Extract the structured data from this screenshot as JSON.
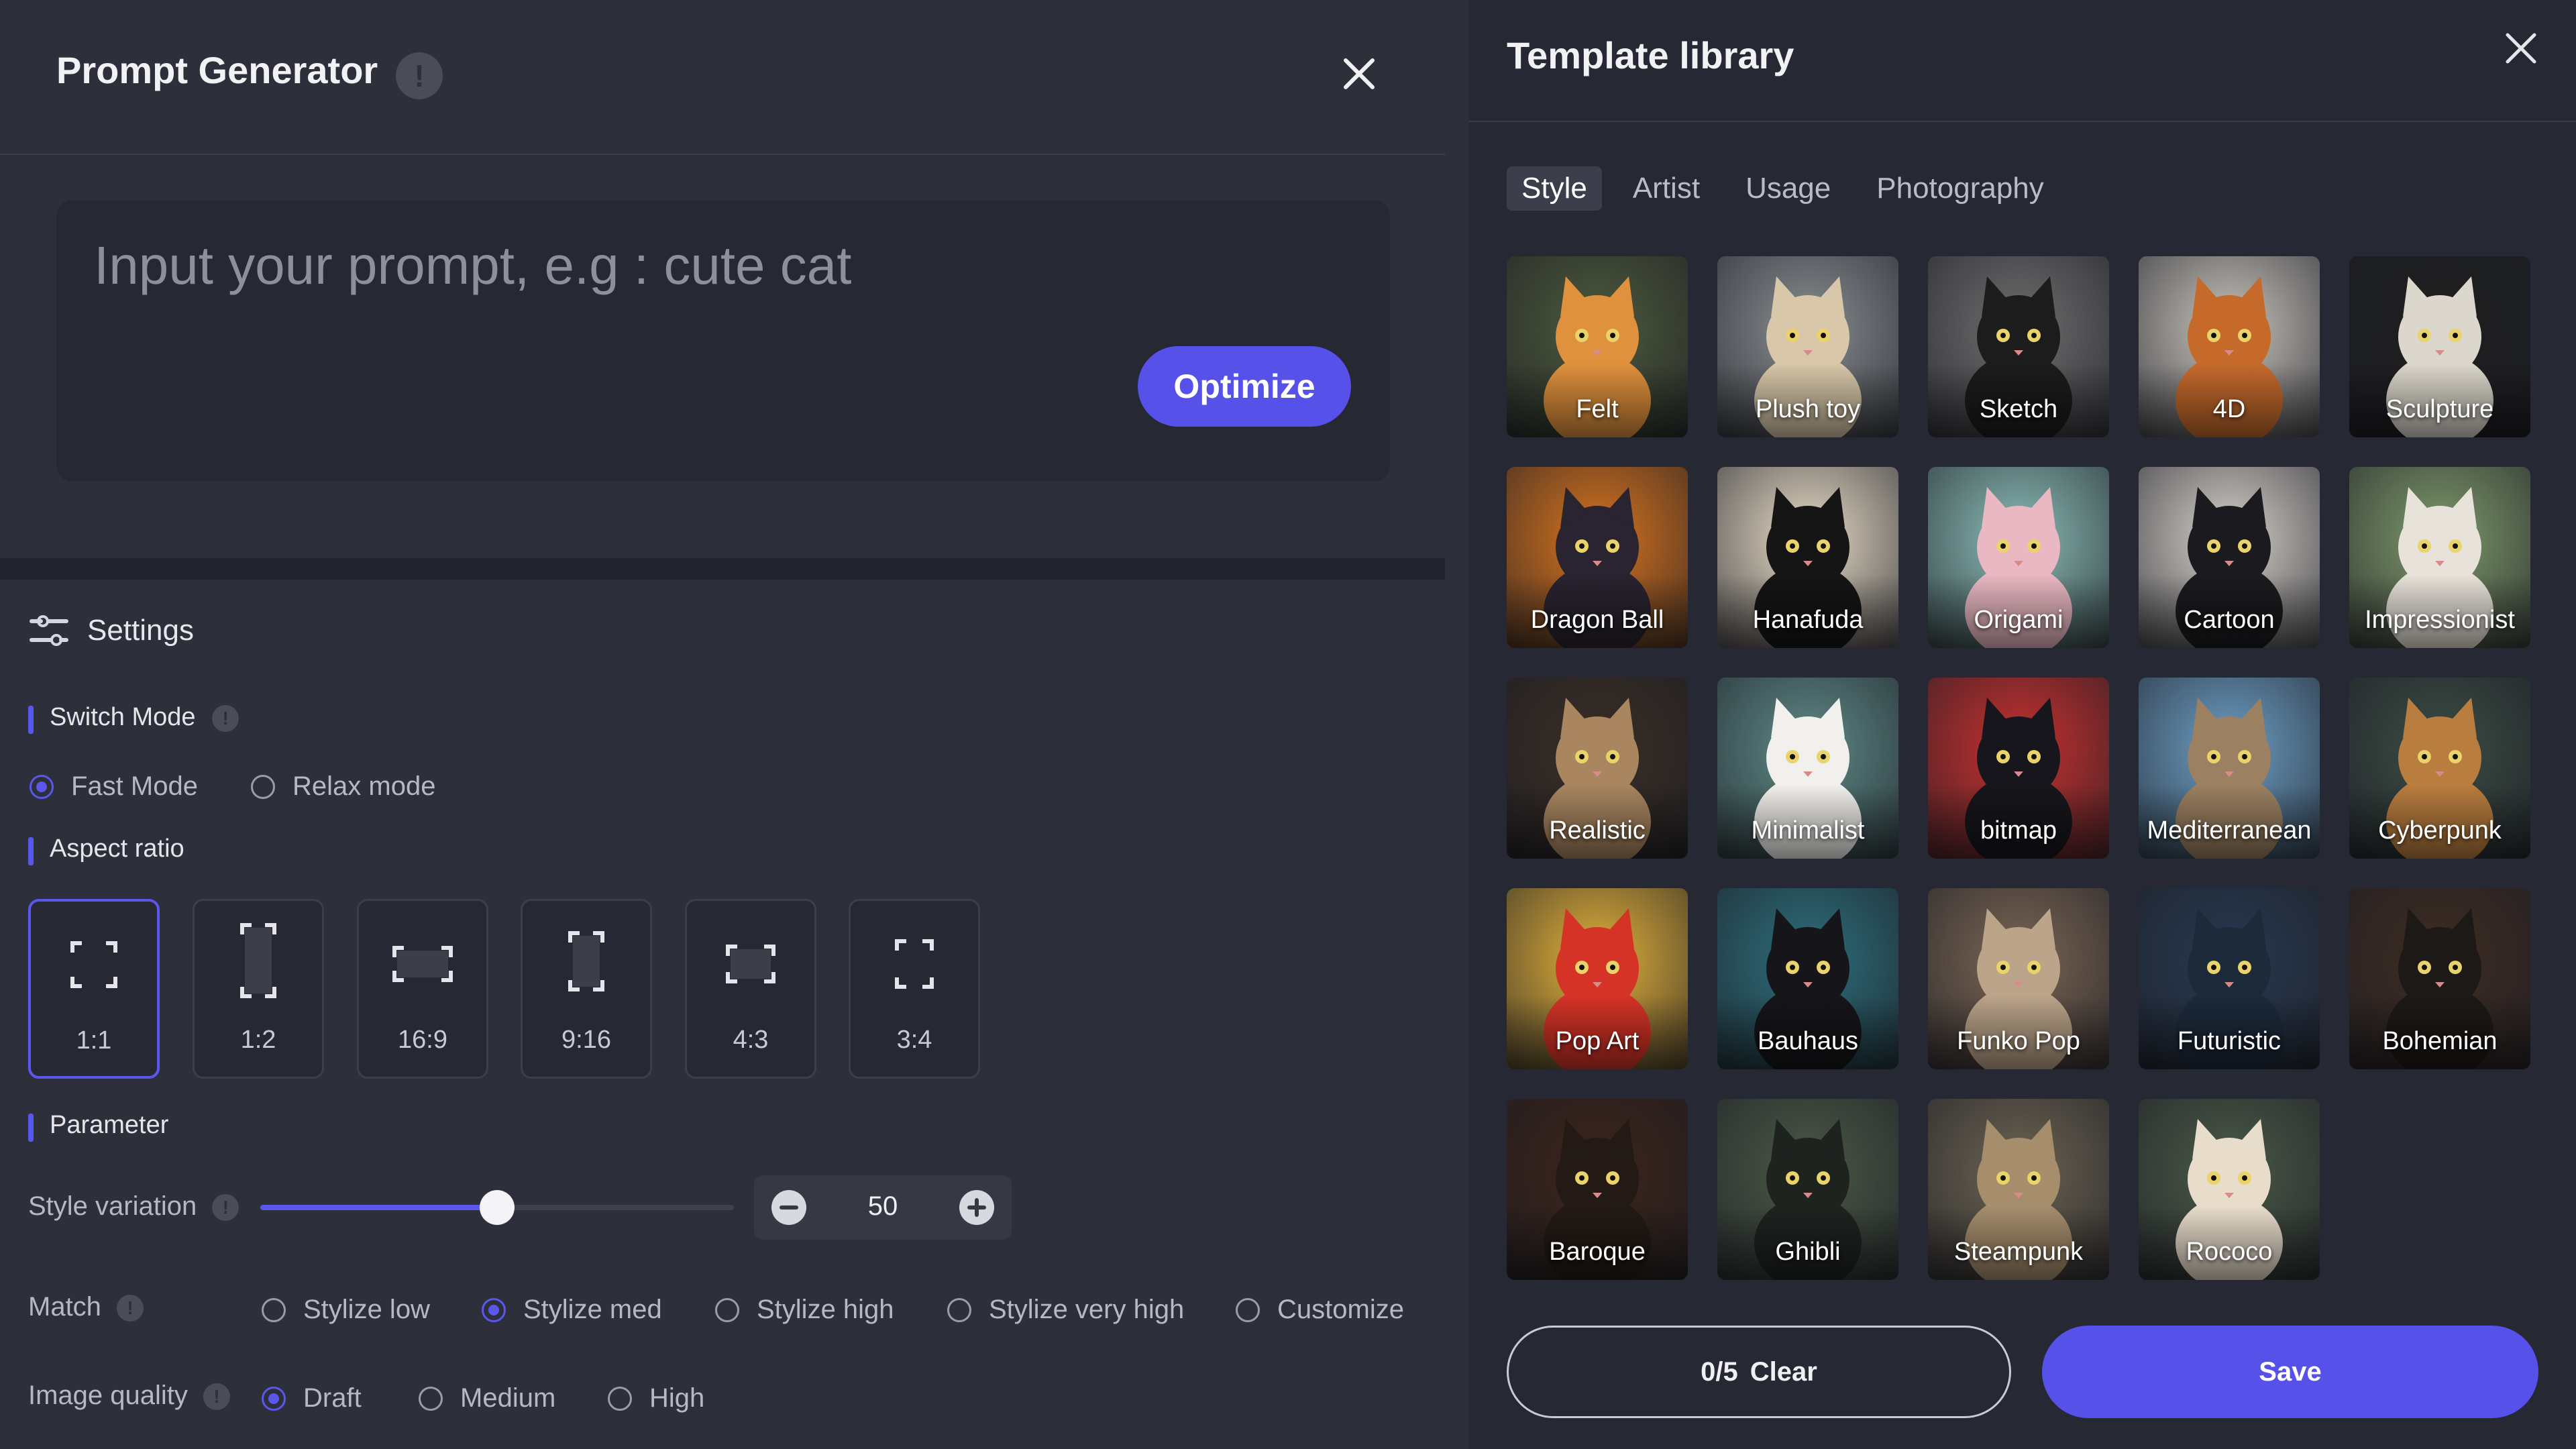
{
  "generator": {
    "title": "Prompt Generator",
    "prompt_placeholder": "Input your prompt, e.g : cute cat",
    "optimize_label": "Optimize"
  },
  "settings": {
    "heading": "Settings",
    "switch_mode": {
      "label": "Switch Mode",
      "options": [
        "Fast Mode",
        "Relax mode"
      ],
      "selected": "Fast Mode"
    },
    "aspect_ratio": {
      "label": "Aspect ratio",
      "options": [
        "1:1",
        "1:2",
        "16:9",
        "9:16",
        "4:3",
        "3:4"
      ],
      "selected": "1:1"
    },
    "parameter": {
      "label": "Parameter",
      "style_variation": {
        "label": "Style variation",
        "value": "50",
        "value_fraction": 0.5
      },
      "match": {
        "label": "Match",
        "options": [
          "Stylize low",
          "Stylize med",
          "Stylize high",
          "Stylize very high",
          "Customize"
        ],
        "selected": "Stylize med"
      },
      "image_quality": {
        "label": "Image quality",
        "options": [
          "Draft",
          "Medium",
          "High"
        ],
        "selected": "Draft"
      }
    }
  },
  "library": {
    "title": "Template library",
    "tabs": [
      "Style",
      "Artist",
      "Usage",
      "Photography"
    ],
    "active_tab": "Style",
    "templates": [
      {
        "label": "Felt",
        "bg": "#4d5a3c",
        "cat": "#e0913d"
      },
      {
        "label": "Plush toy",
        "bg": "#8a8f92",
        "cat": "#d8c7a8"
      },
      {
        "label": "Sketch",
        "bg": "#6f6f6f",
        "cat": "#1c1c1c"
      },
      {
        "label": "4D",
        "bg": "#c9c5bd",
        "cat": "#c66a2c"
      },
      {
        "label": "Sculpture",
        "bg": "#1e1e1e",
        "cat": "#dcd7cc"
      },
      {
        "label": "Dragon Ball",
        "bg": "#d8741f",
        "cat": "#2a2330"
      },
      {
        "label": "Hanafuda",
        "bg": "#e9ddc8",
        "cat": "#151515"
      },
      {
        "label": "Origami",
        "bg": "#8bbdb7",
        "cat": "#e9b8c2"
      },
      {
        "label": "Cartoon",
        "bg": "#d8d3cc",
        "cat": "#1b1b1f"
      },
      {
        "label": "Impressionist",
        "bg": "#7f9a6c",
        "cat": "#e8e3da"
      },
      {
        "label": "Realistic",
        "bg": "#3a2e25",
        "cat": "#a98560"
      },
      {
        "label": "Minimalist",
        "bg": "#5f8b88",
        "cat": "#f2f0ec"
      },
      {
        "label": "bitmap",
        "bg": "#c9312f",
        "cat": "#17161c"
      },
      {
        "label": "Mediterranean",
        "bg": "#6da0c6",
        "cat": "#9b8061"
      },
      {
        "label": "Cyberpunk",
        "bg": "#3b4c44",
        "cat": "#b97d3f"
      },
      {
        "label": "Pop Art",
        "bg": "#e4b23b",
        "cat": "#d53326"
      },
      {
        "label": "Bauhaus",
        "bg": "#2d6f7c",
        "cat": "#16161a"
      },
      {
        "label": "Funko Pop",
        "bg": "#7b6654",
        "cat": "#bba48a"
      },
      {
        "label": "Futuristic",
        "bg": "#283a52",
        "cat": "#1c2a3a"
      },
      {
        "label": "Bohemian",
        "bg": "#3f2c22",
        "cat": "#1d1916"
      },
      {
        "label": "Baroque",
        "bg": "#3d2419",
        "cat": "#231a15"
      },
      {
        "label": "Ghibli",
        "bg": "#4b5a47",
        "cat": "#1e2320"
      },
      {
        "label": "Steampunk",
        "bg": "#6c6452",
        "cat": "#a68e6d"
      },
      {
        "label": "Rococo",
        "bg": "#4b5a48",
        "cat": "#e8dccb"
      }
    ],
    "selection_count": "0/5",
    "clear_label": "Clear",
    "save_label": "Save"
  },
  "colors": {
    "accent": "#5551e9",
    "panel_bg": "#2d2f3b",
    "library_bg": "#262834"
  }
}
